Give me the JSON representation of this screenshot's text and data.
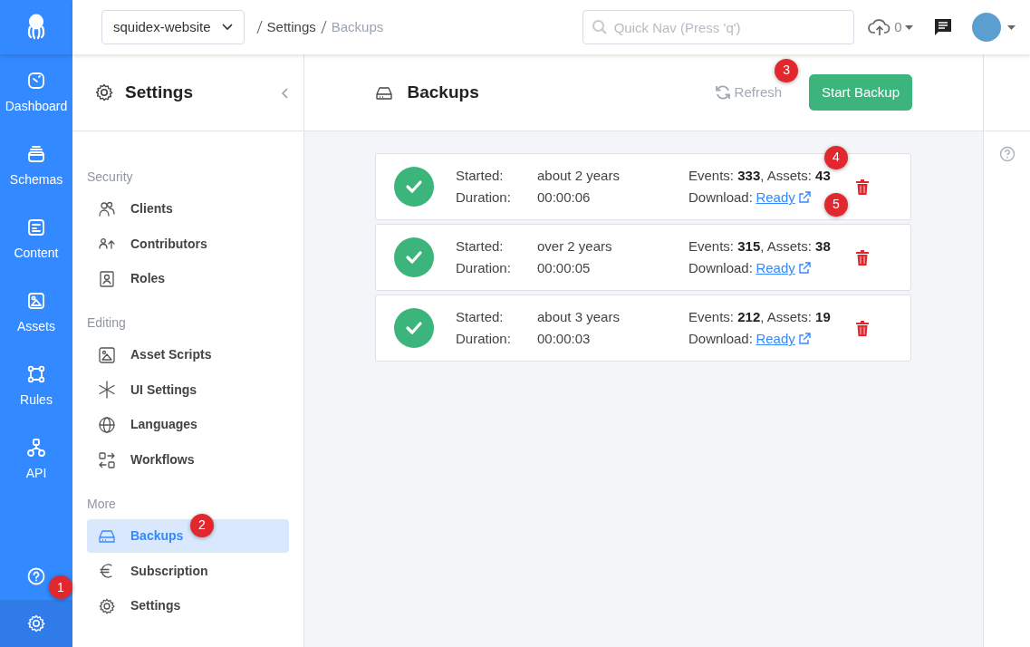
{
  "app_selector": {
    "value": "squidex-website"
  },
  "breadcrumb": [
    {
      "label": "Settings",
      "current": false
    },
    {
      "label": "Backups",
      "current": true
    }
  ],
  "search": {
    "placeholder": "Quick Nav (Press 'q')"
  },
  "uploads": {
    "count": "0"
  },
  "rail": {
    "items": [
      {
        "label": "Dashboard",
        "kind": "dashboard",
        "selected": false
      },
      {
        "label": "Schemas",
        "kind": "schemas",
        "selected": false
      },
      {
        "label": "Content",
        "kind": "content",
        "selected": false
      },
      {
        "label": "Assets",
        "kind": "assets",
        "selected": false
      },
      {
        "label": "Rules",
        "kind": "rules",
        "selected": false
      },
      {
        "label": "API",
        "kind": "api",
        "selected": false
      }
    ],
    "bottom": [
      {
        "kind": "help",
        "selected": false
      },
      {
        "kind": "settings",
        "selected": true,
        "callout": "1"
      }
    ]
  },
  "settings_panel": {
    "title": "Settings",
    "groups": [
      {
        "label": "Security",
        "items": [
          {
            "label": "Clients",
            "kind": "clients",
            "selected": false
          },
          {
            "label": "Contributors",
            "kind": "contributors",
            "selected": false
          },
          {
            "label": "Roles",
            "kind": "roles",
            "selected": false
          }
        ]
      },
      {
        "label": "Editing",
        "items": [
          {
            "label": "Asset Scripts",
            "kind": "assetscripts",
            "selected": false
          },
          {
            "label": "UI Settings",
            "kind": "uisettings",
            "selected": false
          },
          {
            "label": "Languages",
            "kind": "languages",
            "selected": false
          },
          {
            "label": "Workflows",
            "kind": "workflows",
            "selected": false
          }
        ]
      },
      {
        "label": "More",
        "items": [
          {
            "label": "Backups",
            "kind": "backups",
            "selected": true,
            "callout": "2"
          },
          {
            "label": "Subscription",
            "kind": "subscription",
            "selected": false
          },
          {
            "label": "Settings",
            "kind": "settings",
            "selected": false
          }
        ]
      }
    ]
  },
  "page": {
    "title": "Backups",
    "refresh": "Refresh",
    "start": "Start Backup",
    "start_callout": "3"
  },
  "backups": [
    {
      "succeeded": true,
      "started_label": "Started:",
      "started": "about 2 years",
      "duration_label": "Duration:",
      "duration": "00:00:06",
      "counts": "Events: **333**, Assets: **43**",
      "download_label": "Download:",
      "download": "Ready",
      "counts_callout": "4",
      "download_callout": "5"
    },
    {
      "succeeded": true,
      "started_label": "Started:",
      "started": "over 2 years",
      "duration_label": "Duration:",
      "duration": "00:00:05",
      "counts": "Events: **315**, Assets: **38**",
      "download_label": "Download:",
      "download": "Ready"
    },
    {
      "succeeded": true,
      "started_label": "Started:",
      "started": "about 3 years",
      "duration_label": "Duration:",
      "duration": "00:00:03",
      "counts": "Events: **212**, Assets: **19**",
      "download_label": "Download:",
      "download": "Ready"
    }
  ]
}
